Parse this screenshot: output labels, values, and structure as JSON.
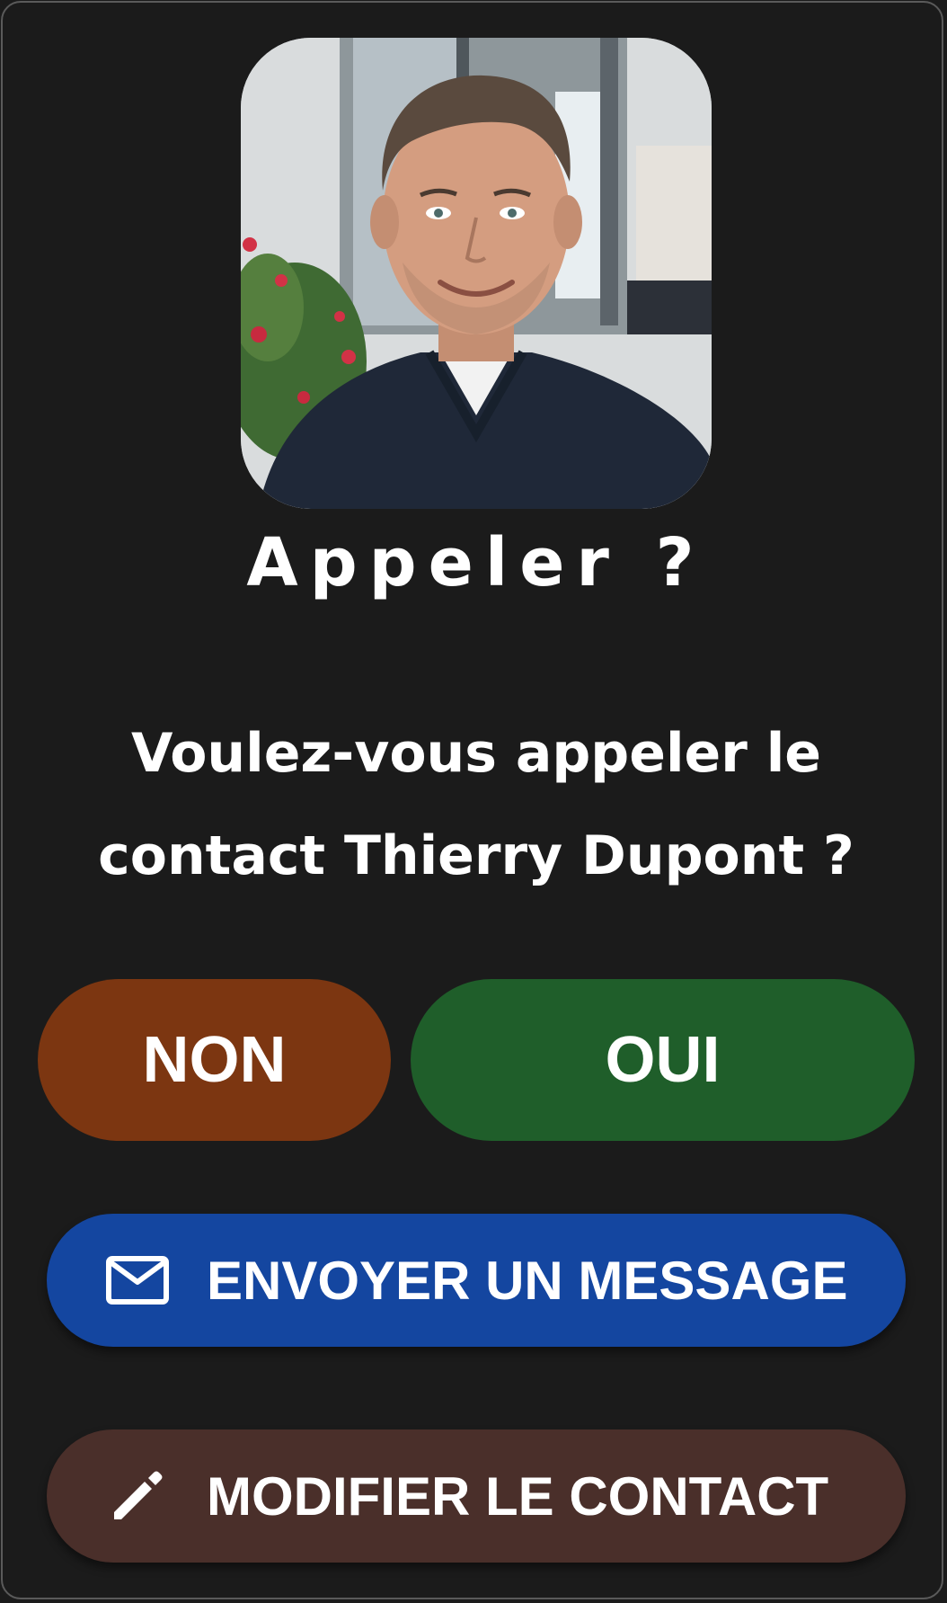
{
  "dialog": {
    "title": "Appeler ?",
    "question": "Voulez-vous appeler le contact Thierry Dupont ?"
  },
  "buttons": {
    "no_label": "NON",
    "yes_label": "OUI",
    "message_label": "ENVOYER UN MESSAGE",
    "message_icon": "mail-icon",
    "edit_label": "MODIFIER LE CONTACT",
    "edit_icon": "pencil-icon"
  },
  "colors": {
    "background": "#1b1b1b",
    "no_button": "#7c3611",
    "yes_button": "#1f5e2a",
    "message_button": "#1446a0",
    "edit_button": "#4a2f2a",
    "text": "#ffffff"
  }
}
